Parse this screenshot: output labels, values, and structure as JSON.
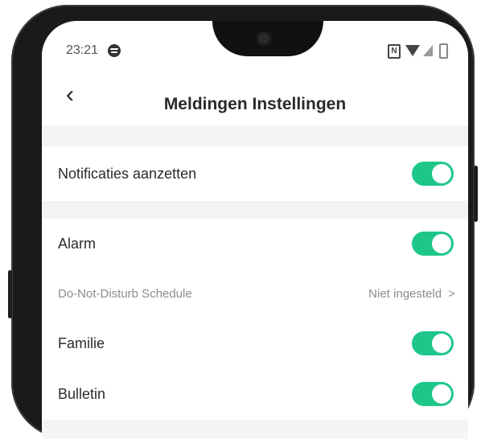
{
  "status_bar": {
    "time": "23:21",
    "icons": [
      "spotify-icon",
      "nfc-icon",
      "wifi-icon",
      "signal-icon",
      "battery-icon"
    ],
    "nfc_label": "N"
  },
  "header": {
    "back_icon": "‹",
    "title": "Meldingen Instellingen"
  },
  "settings": {
    "notifications": {
      "label": "Notificaties aanzetten",
      "enabled": true
    },
    "alarm": {
      "label": "Alarm",
      "enabled": true
    },
    "dnd": {
      "label": "Do-Not-Disturb Schedule",
      "value": "Niet ingesteld",
      "chevron": ">"
    },
    "family": {
      "label": "Familie",
      "enabled": true
    },
    "bulletin": {
      "label": "Bulletin",
      "enabled": true
    }
  },
  "colors": {
    "toggle_on": "#1ec789",
    "background": "#f5f5f5",
    "phone_bezel": "#1a1a1a"
  }
}
